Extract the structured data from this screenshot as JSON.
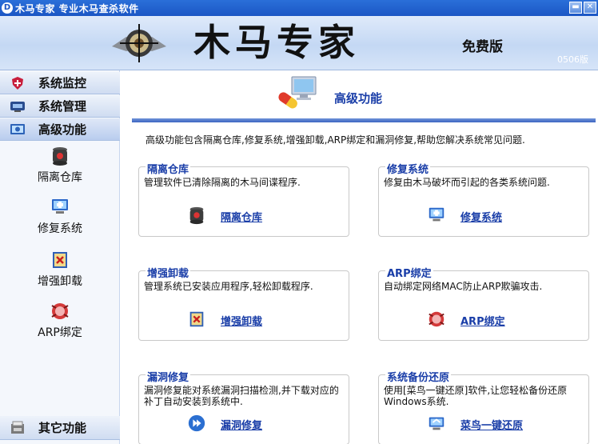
{
  "window": {
    "logo_glyph": "D",
    "title": "木马专家 专业木马查杀软件",
    "minimize_glyph": "▬",
    "close_glyph": "✕"
  },
  "banner": {
    "title": "木马专家",
    "edition": "免费版",
    "version": "0506版"
  },
  "sidebar": {
    "items": [
      {
        "label": "系统监控",
        "icon": "shield-plus-icon"
      },
      {
        "label": "系统管理",
        "icon": "system-manage-icon"
      },
      {
        "label": "高级功能",
        "icon": "advanced-icon"
      }
    ],
    "sub_items": [
      {
        "label": "隔离仓库",
        "icon": "quarantine-jar-icon"
      },
      {
        "label": "修复系统",
        "icon": "repair-monitor-icon"
      },
      {
        "label": "增强卸载",
        "icon": "uninstall-box-icon"
      },
      {
        "label": "ARP绑定",
        "icon": "arp-bug-icon"
      }
    ],
    "bottom_item": {
      "label": "其它功能",
      "icon": "other-functions-icon"
    }
  },
  "main": {
    "title": "高级功能",
    "intro": "高级功能包含隔离仓库,修复系统,增强卸载,ARP绑定和漏洞修复,帮助您解决系统常见问题.",
    "cards": [
      {
        "title": "隔离仓库",
        "desc": "管理软件已清除隔离的木马间谍程序.",
        "link": "隔离仓库",
        "icon": "quarantine-jar-icon"
      },
      {
        "title": "修复系统",
        "desc": "修复由木马破坏而引起的各类系统问题.",
        "link": "修复系统",
        "icon": "repair-monitor-icon"
      },
      {
        "title": "增强卸载",
        "desc": "管理系统已安装应用程序,轻松卸载程序.",
        "link": "增强卸载",
        "icon": "uninstall-box-icon"
      },
      {
        "title": "ARP绑定",
        "desc": "自动绑定网络MAC防止ARP欺骗攻击.",
        "link": "ARP绑定",
        "icon": "arp-bug-icon"
      },
      {
        "title": "漏洞修复",
        "desc": "漏洞修复能对系统漏洞扫描检测,并下载对应的补丁自动安装到系统中.",
        "link": "漏洞修复",
        "icon": "patch-arrow-icon"
      },
      {
        "title": "系统备份还原",
        "desc": "使用[菜鸟一键还原]软件,让您轻松备份还原Windows系统.",
        "link": "菜鸟一键还原",
        "icon": "backup-restore-icon"
      }
    ]
  },
  "colors": {
    "titlebar": "#1b56c4",
    "link": "#1a3ea8",
    "rule": "#3c66c2"
  }
}
